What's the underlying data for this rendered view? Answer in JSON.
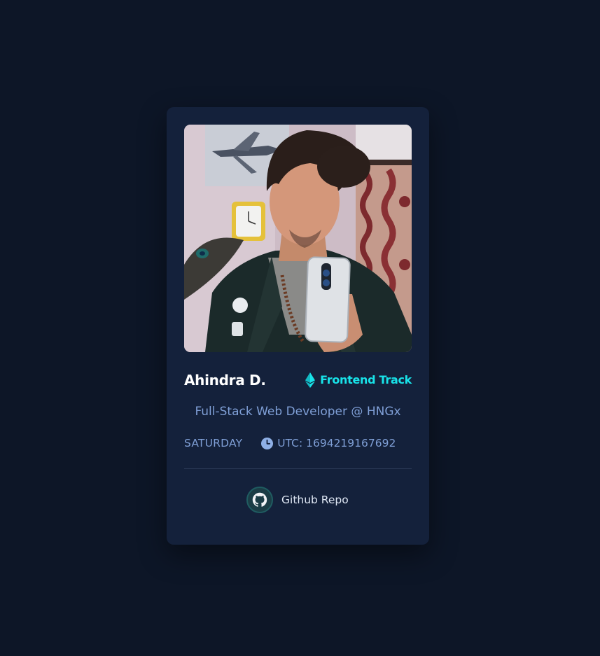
{
  "profile": {
    "name": "Ahindra D.",
    "track": "Frontend Track",
    "role": "Full-Stack Web Developer @ HNGx",
    "day": "SATURDAY",
    "utc": "UTC: 1694219167692",
    "photo_icon": "profile-photo",
    "track_icon": "ethereum-icon",
    "time_icon": "clock-icon"
  },
  "links": {
    "github_label": "Github Repo",
    "github_icon": "github-icon"
  },
  "colors": {
    "background": "#0d1627",
    "card": "#14213b",
    "accent": "#18e3e9",
    "muted_text": "#7f9fd6"
  }
}
